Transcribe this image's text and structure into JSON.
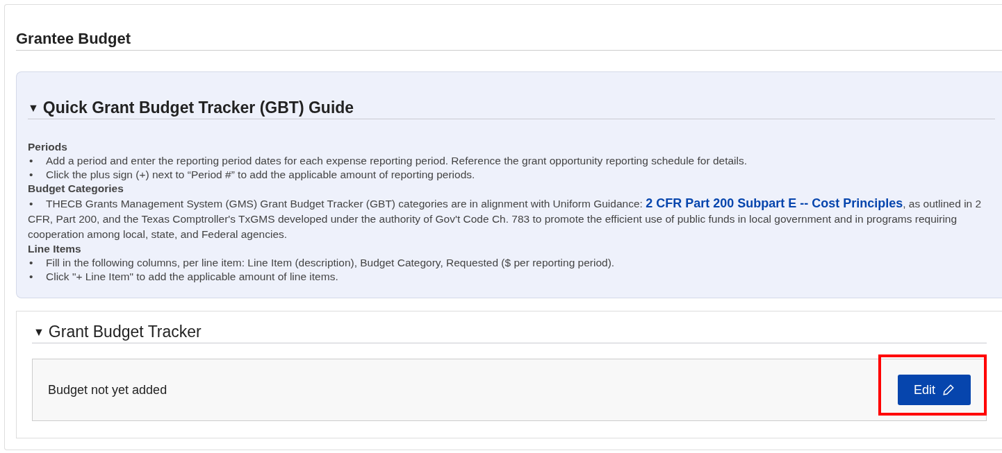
{
  "page_title": "Grantee Budget",
  "guide": {
    "toggle": "▼",
    "title": "Quick Grant Budget Tracker (GBT) Guide",
    "expanded": true,
    "sections": [
      {
        "heading": "Periods",
        "bullets": [
          {
            "bullet": "•",
            "text": "Add a period and enter the reporting period dates for each expense reporting period. Reference the grant opportunity reporting schedule for details."
          },
          {
            "bullet": "•",
            "text": "Click the plus sign (+) next to “Period #” to add the applicable amount of reporting periods."
          }
        ]
      },
      {
        "heading": "Budget Categories",
        "bullets": [
          {
            "bullet": "•",
            "text": "THECB Grants Management System (GMS) Grant Budget Tracker (GBT) categories are in alignment with Uniform Guidance: ",
            "link": "2 CFR Part 200 Subpart E -- Cost Principles",
            "after": ", as outlined in 2 CFR, Part 200, and the Texas Comptroller's TxGMS developed under the authority of Gov't Code Ch. 783 to promote the efficient use of public funds in local government and in programs requiring cooperation among local, state, and Federal agencies."
          }
        ]
      },
      {
        "heading": "Line Items",
        "bullets": [
          {
            "bullet": "•",
            "text": "Fill in the following columns, per line item: Line Item (description), Budget Category, Requested ($ per reporting period)."
          },
          {
            "bullet": "•",
            "text": "Click \"+ Line Item\" to add the applicable amount of line items."
          }
        ]
      }
    ]
  },
  "tracker": {
    "toggle": "▼",
    "title": "Grant Budget Tracker",
    "expanded": true,
    "status": "Budget not yet added",
    "button": "Edit",
    "highlighted": true
  }
}
